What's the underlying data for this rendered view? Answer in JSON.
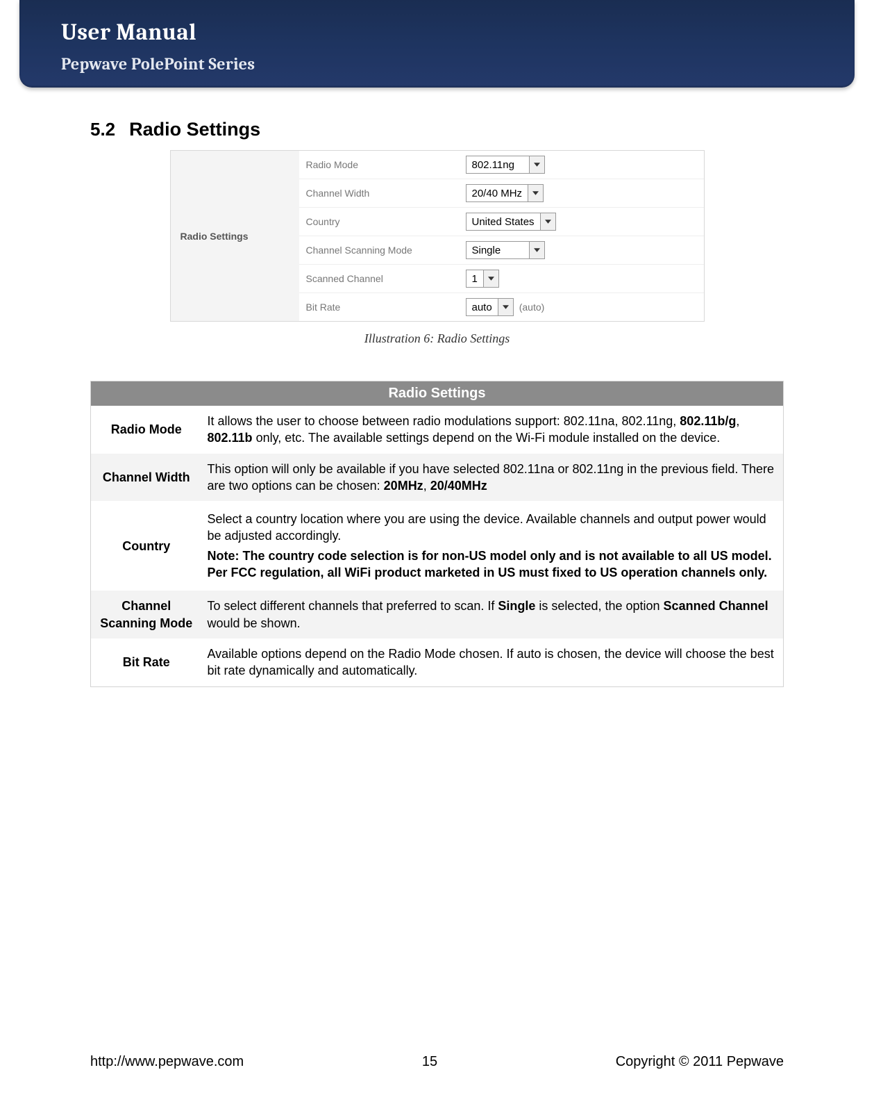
{
  "banner": {
    "title": "User Manual",
    "subtitle": "Pepwave PolePoint Series"
  },
  "section": {
    "number": "5.2",
    "title": "Radio Settings"
  },
  "panel": {
    "side_label": "Radio Settings",
    "rows": {
      "radio_mode": {
        "label": "Radio Mode",
        "value": "802.11ng"
      },
      "channel_width": {
        "label": "Channel Width",
        "value": "20/40 MHz"
      },
      "country": {
        "label": "Country",
        "value": "United States"
      },
      "scan_mode": {
        "label": "Channel Scanning Mode",
        "value": "Single"
      },
      "scanned_channel": {
        "label": "Scanned Channel",
        "value": "1"
      },
      "bit_rate": {
        "label": "Bit Rate",
        "value": "auto",
        "hint": "(auto)"
      }
    }
  },
  "caption": "Illustration 6: Radio Settings",
  "desc": {
    "header": "Radio Settings",
    "rows": [
      {
        "term": "Radio Mode",
        "body_pre": "It allows the user to choose between radio modulations support: 802.11na, 802.11ng, ",
        "body_b1": "802.11b/g",
        "body_mid1": ", ",
        "body_b2": "802.11b",
        "body_post": " only, etc.  The available settings depend on the Wi-Fi module installed on the device."
      },
      {
        "term": "Channel Width",
        "body_pre": "This option will only be available if you have selected 802.11na or 802.11ng in the previous field. There are two options can be chosen: ",
        "body_b1": "20MHz",
        "body_mid1": ", ",
        "body_b2": "20/40MHz",
        "body_post": ""
      },
      {
        "term": "Country",
        "para1": "Select a country location where you are using the device. Available channels and output power would be adjusted accordingly.",
        "para2_bold": "Note: The country code selection is for non-US model only and is not available to all US model. Per FCC regulation, all WiFi product marketed in US must fixed to US operation channels only."
      },
      {
        "term": "Channel Scanning Mode",
        "body_pre": "To select different channels that preferred to scan. If ",
        "body_b1": "Single",
        "body_mid1": " is selected, the option ",
        "body_b2": "Scanned Channel",
        "body_post": " would be shown."
      },
      {
        "term": "Bit Rate",
        "body_pre": "Available options depend on the Radio Mode chosen.  If auto is chosen, the device will choose the best bit rate dynamically and automatically.",
        "body_b1": "",
        "body_mid1": "",
        "body_b2": "",
        "body_post": ""
      }
    ]
  },
  "footer": {
    "url": "http://www.pepwave.com",
    "page": "15",
    "copyright": "Copyright © 2011 Pepwave"
  }
}
